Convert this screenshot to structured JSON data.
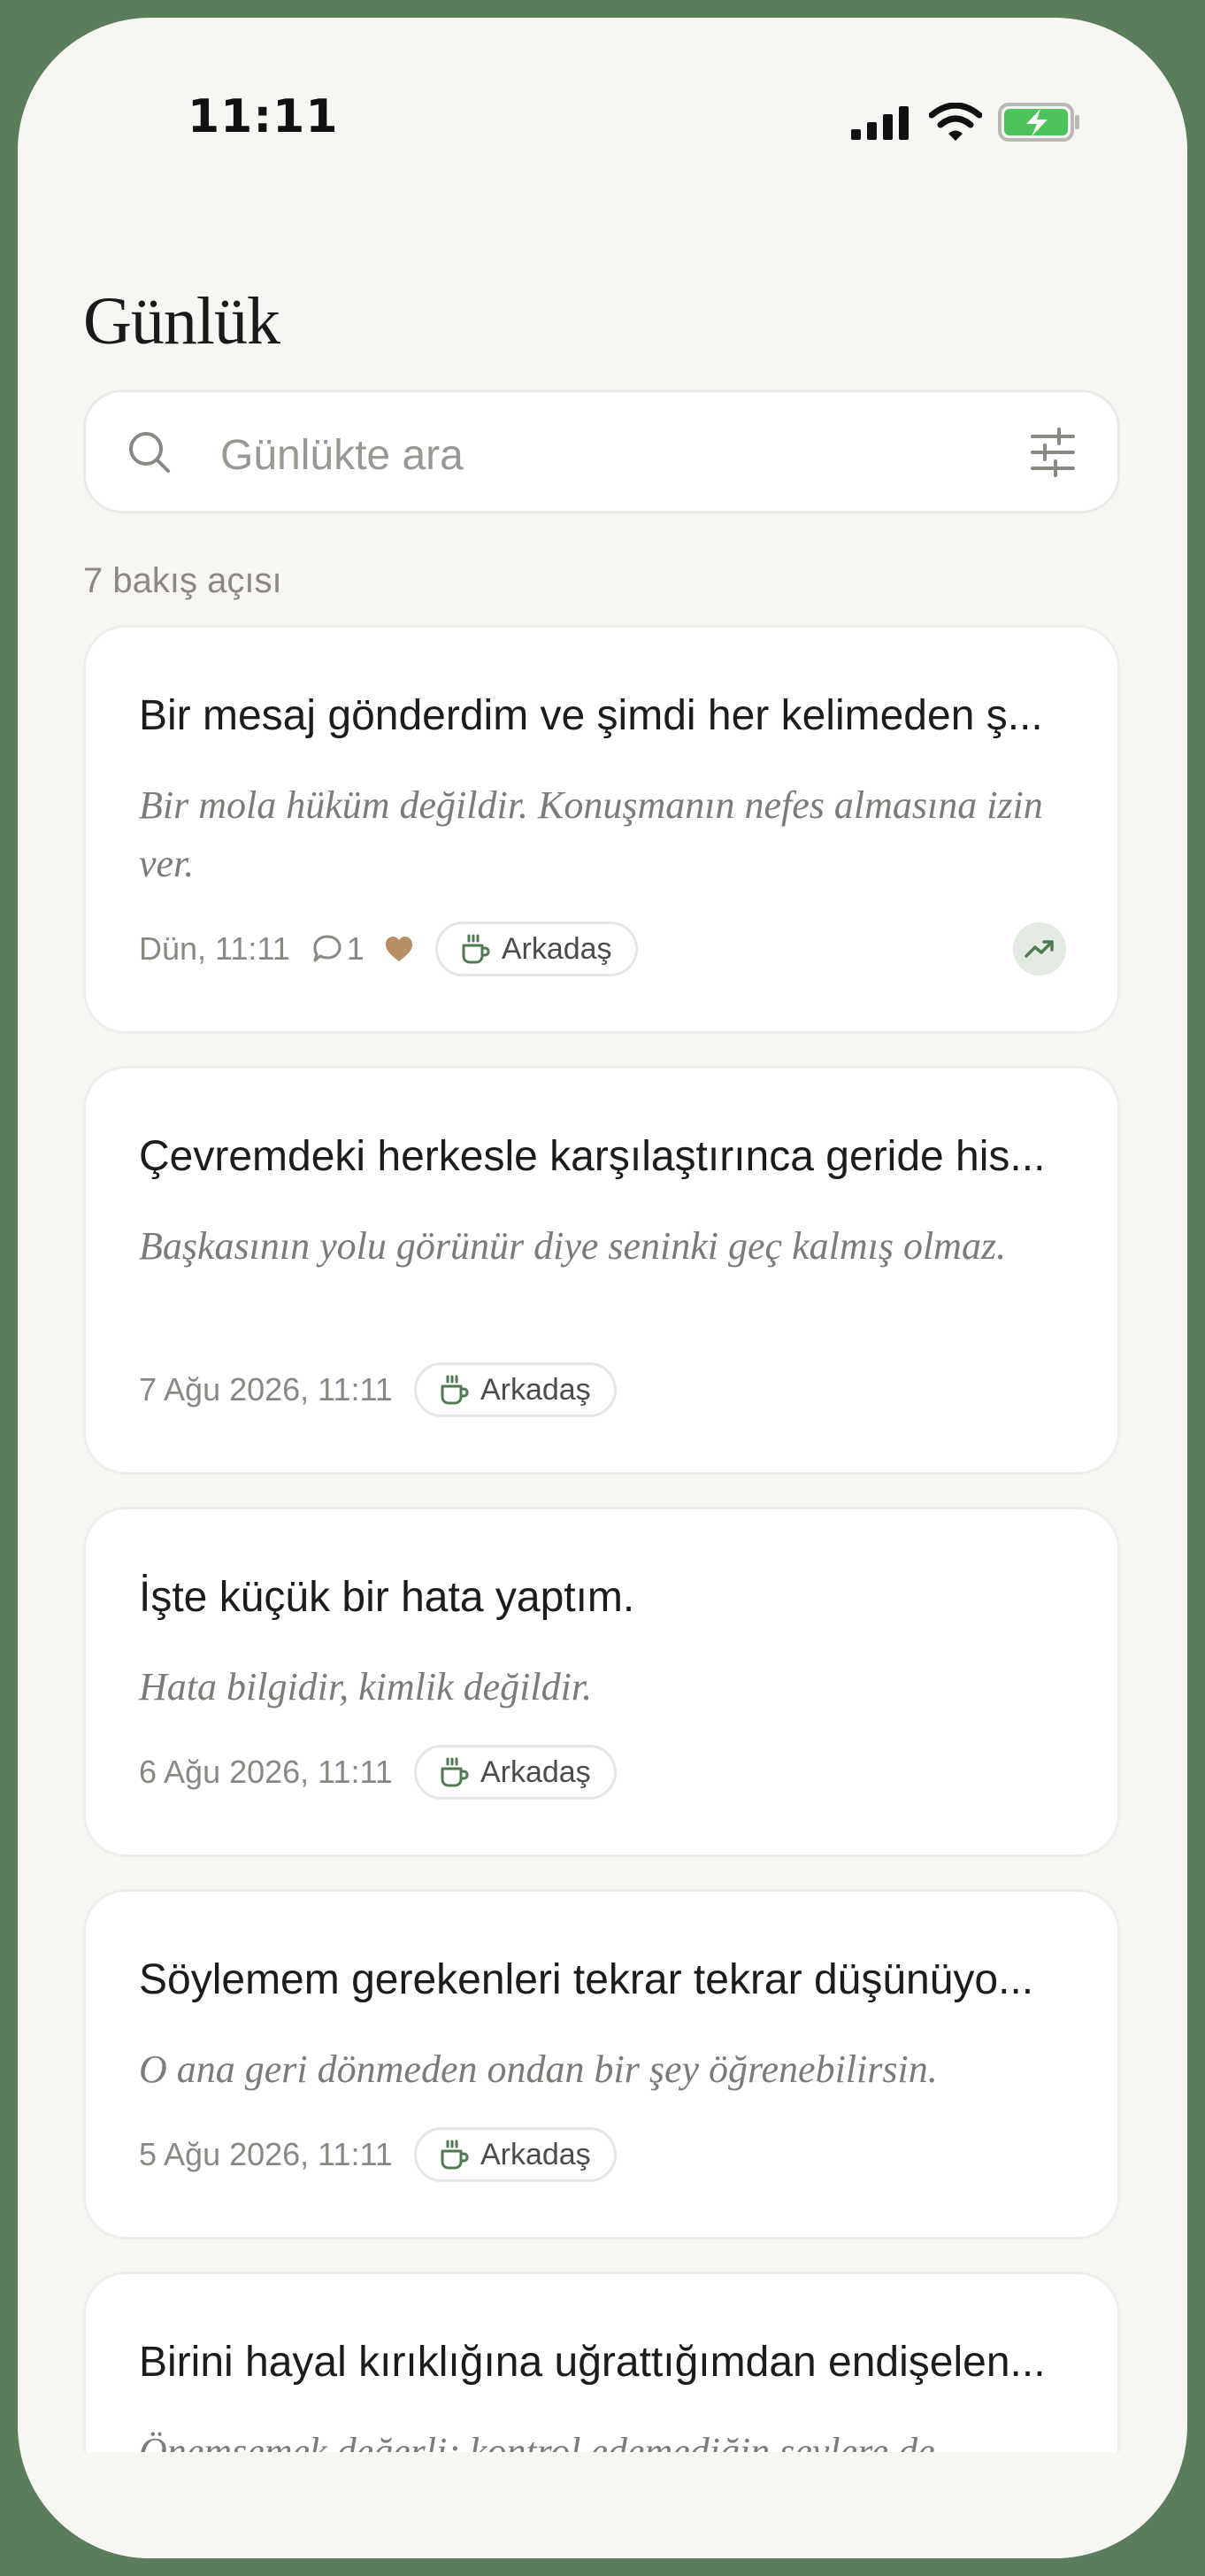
{
  "status_bar": {
    "time": "11:11"
  },
  "header": {
    "title": "Günlük"
  },
  "search": {
    "placeholder": "Günlükte ara"
  },
  "list": {
    "count_label": "7 bakış açısı",
    "entries": [
      {
        "title": "Bir mesaj gönderdim ve şimdi her kelimeden ş...",
        "excerpt": "Bir mola hüküm değildir. Konuşmanın nefes almasına izin ver.",
        "date": "Dün, 11:11",
        "comment_count": "1",
        "liked": true,
        "tag": "Arkadaş",
        "trend_icon": "trending-up-icon"
      },
      {
        "title": "Çevremdeki herkesle karşılaştırınca geride his...",
        "excerpt": "Başkasının yolu görünür diye seninki geç kalmış olmaz.",
        "date": "7 Ağu 2026, 11:11",
        "tag": "Arkadaş"
      },
      {
        "title": "İşte küçük bir hata yaptım.",
        "excerpt": "Hata bilgidir, kimlik değildir.",
        "date": "6 Ağu 2026, 11:11",
        "tag": "Arkadaş"
      },
      {
        "title": "Söylemem gerekenleri tekrar tekrar düşünüyo...",
        "excerpt": "O ana geri dönmeden ondan bir şey öğrenebilirsin.",
        "date": "5 Ağu 2026, 11:11",
        "tag": "Arkadaş"
      },
      {
        "title": "Birini hayal kırıklığına uğrattığımdan endişelen...",
        "excerpt": "Önemsemek değerli; kontrol edemediğin şeylere de"
      }
    ]
  },
  "colors": {
    "frame": "#5b7d5c",
    "background": "#f7f6f3",
    "accent_green": "#4f7a52",
    "heart": "#b88f64",
    "battery": "#4cc45c"
  }
}
